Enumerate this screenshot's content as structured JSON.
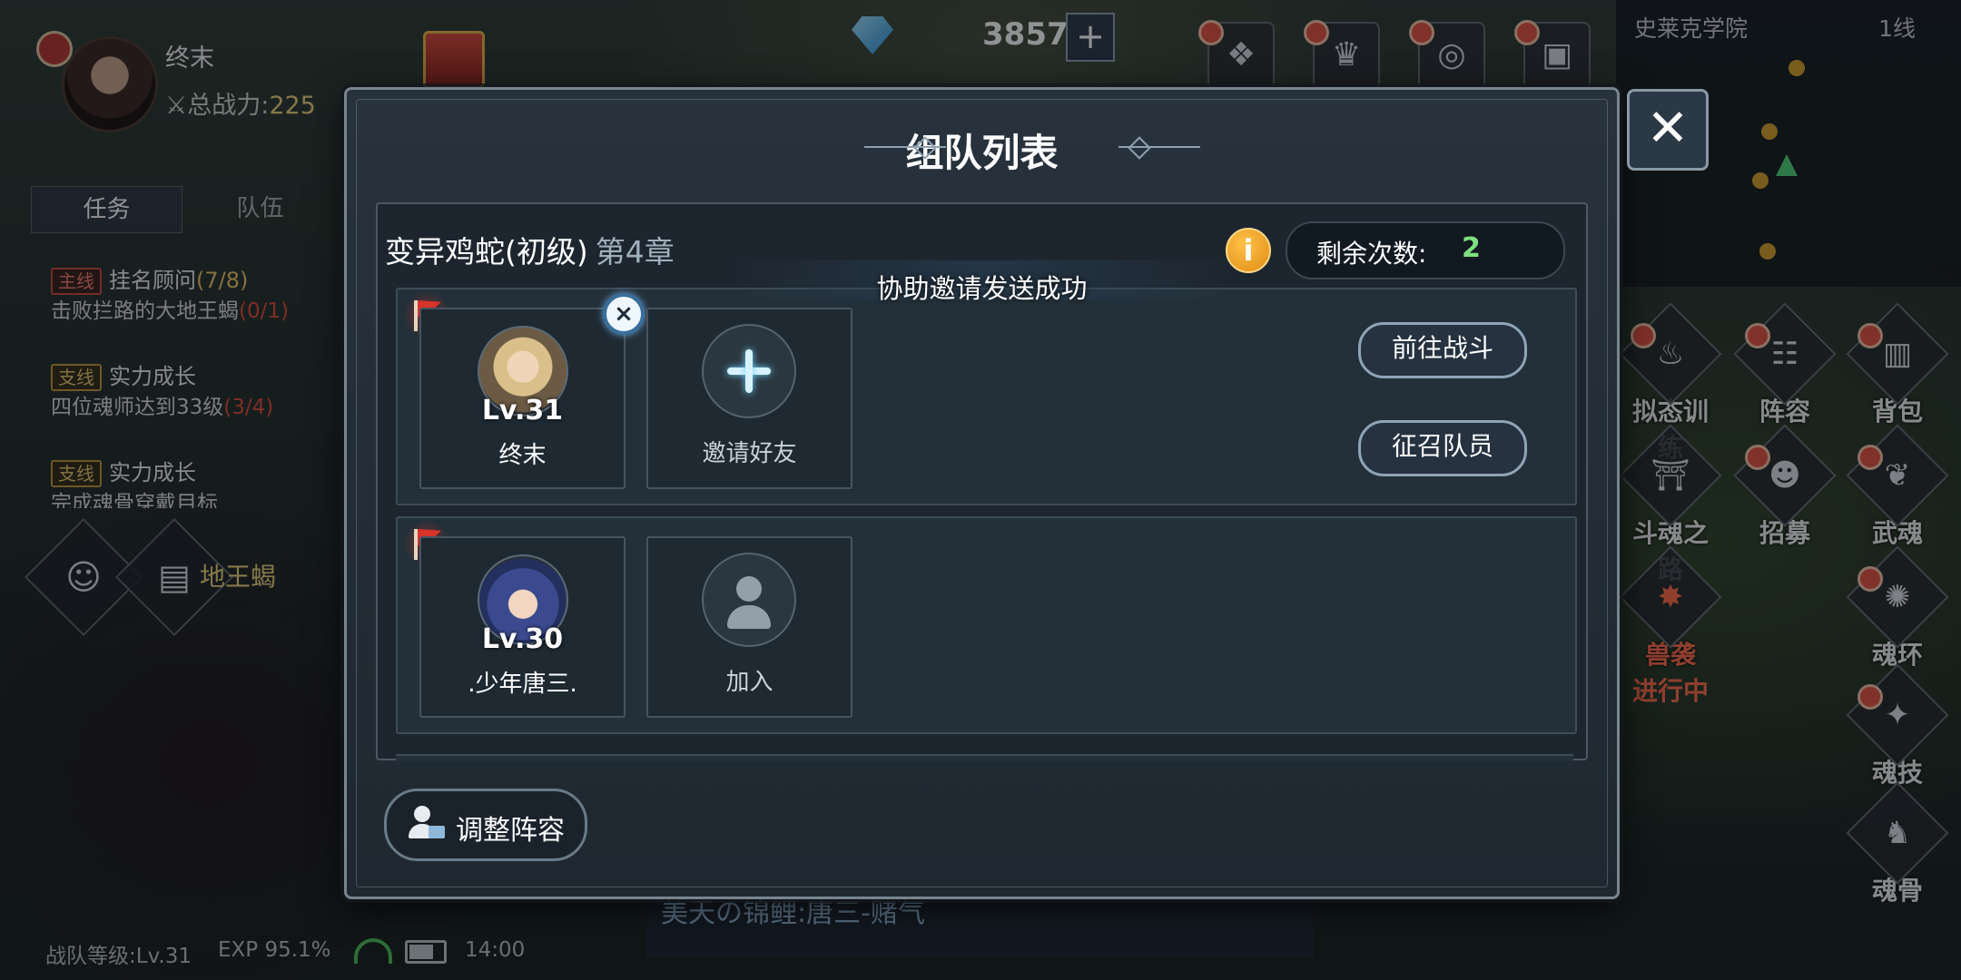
{
  "player": {
    "name": "终末",
    "power_label": "总战力:",
    "power_value": "225"
  },
  "left_tabs": [
    "任务",
    "队伍"
  ],
  "quests": [
    {
      "tag": "主线",
      "title": "挂名顾问",
      "progress": "(7/8)",
      "desc": "击败拦路的大地王蝎",
      "desc_progress": "(0/1)"
    },
    {
      "tag": "支线",
      "title": "实力成长",
      "progress": "",
      "desc": "四位魂师达到33级",
      "desc_progress": "(3/4)"
    },
    {
      "tag": "支线",
      "title": "实力成长",
      "progress": "",
      "desc": "完成魂骨穿戴目标",
      "desc_progress": ""
    }
  ],
  "chat_tail": "地王蝎",
  "currency": {
    "gems": "3857",
    "plus": "+"
  },
  "minimap": {
    "area": "史莱克学院",
    "line": "1线"
  },
  "right_menu": [
    {
      "label": "拟态训练"
    },
    {
      "label": "阵容"
    },
    {
      "label": "背包"
    },
    {
      "label": "斗魂之路"
    },
    {
      "label": "招募"
    },
    {
      "label": "武魂"
    },
    {
      "label": "兽袭",
      "sub": "进行中"
    },
    {
      "label": "魂环"
    },
    {
      "label": "魂技"
    },
    {
      "label": "魂骨"
    }
  ],
  "status_bar": {
    "team_level": "战队等级:Lv.31",
    "exp": "EXP 95.1%",
    "time": "14:00"
  },
  "chat_strip": "美天の锦鲤:唐三-赌气",
  "modal": {
    "title": "组队列表",
    "close": "✕",
    "dungeon": "变异鸡蛇(初级)",
    "chapter": "第4章",
    "info": "i",
    "remaining_label": "剩余次数:",
    "remaining_value": "2",
    "toast": "协助邀请发送成功",
    "teams": [
      {
        "leader": {
          "level": "Lv.31",
          "name": "终末"
        },
        "slot": {
          "label": "邀请好友"
        },
        "buttons": [
          "前往战斗",
          "征召队员"
        ]
      },
      {
        "leader": {
          "level": "Lv.30",
          "name": ".少年唐三."
        },
        "slot": {
          "label": "加入"
        }
      }
    ],
    "adjust_button": "调整阵容"
  }
}
